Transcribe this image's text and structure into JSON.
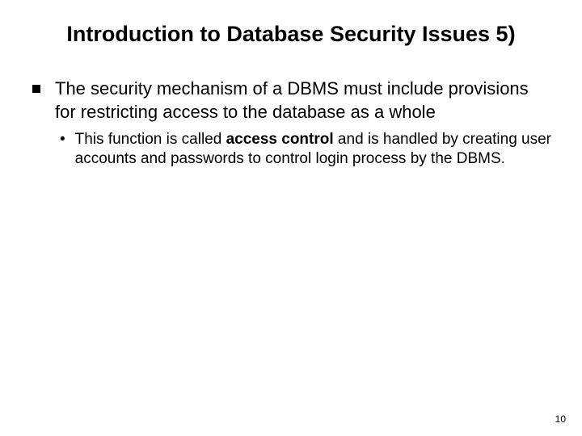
{
  "slide": {
    "title": "Introduction to Database Security Issues 5)",
    "bullet1": "The security mechanism of a DBMS must include provisions for restricting access to the database as a whole",
    "sub_pre": "This function is called ",
    "sub_bold": "access control",
    "sub_post": " and is handled by creating user accounts and passwords to control login process by the DBMS.",
    "page_number": "10"
  }
}
